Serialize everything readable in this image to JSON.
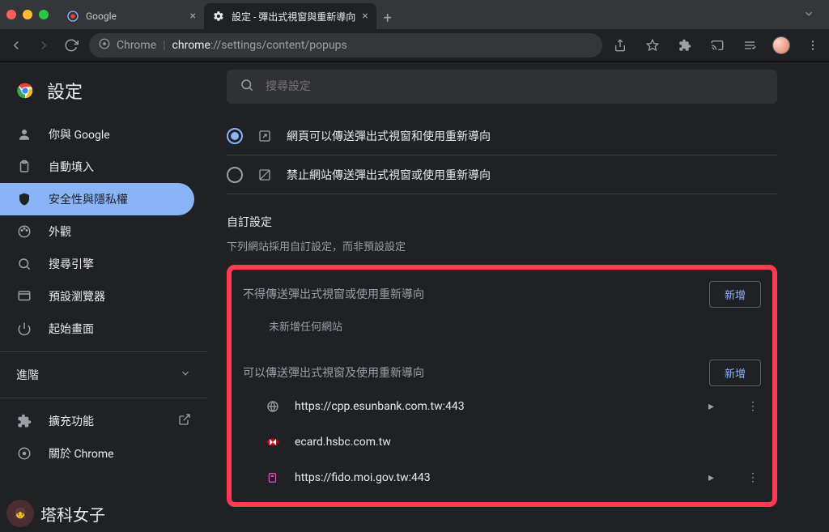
{
  "browser": {
    "tabs": [
      {
        "title": "Google",
        "active": false
      },
      {
        "title": "設定 - 彈出式視窗與重新導向",
        "active": true
      }
    ],
    "omnibox": {
      "scheme": "Chrome",
      "host": "chrome",
      "path": "://settings/content/popups"
    }
  },
  "sidebar": {
    "title": "設定",
    "items": [
      {
        "label": "你與 Google"
      },
      {
        "label": "自動填入"
      },
      {
        "label": "安全性與隱私權"
      },
      {
        "label": "外觀"
      },
      {
        "label": "搜尋引擎"
      },
      {
        "label": "預設瀏覽器"
      },
      {
        "label": "起始畫面"
      }
    ],
    "advanced": "進階",
    "extensions": "擴充功能",
    "about": "關於 Chrome"
  },
  "search": {
    "placeholder": "搜尋設定"
  },
  "radios": {
    "allow": "網頁可以傳送彈出式視窗和使用重新導向",
    "block": "禁止網站傳送彈出式視窗或使用重新導向"
  },
  "custom": {
    "heading": "自訂設定",
    "sub": "下列網站採用自訂設定，而非預設設定",
    "blocked": {
      "title": "不得傳送彈出式視窗或使用重新導向",
      "add": "新增",
      "empty": "未新增任何網站"
    },
    "allowed": {
      "title": "可以傳送彈出式視窗及使用重新導向",
      "add": "新增",
      "sites": [
        {
          "url": "https://cpp.esunbank.com.tw:443",
          "fav": "globe"
        },
        {
          "url": "ecard.hsbc.com.tw",
          "fav": "hsbc"
        },
        {
          "url": "https://fido.moi.gov.tw:443",
          "fav": "pink"
        }
      ]
    }
  },
  "watermark": "塔科女子"
}
